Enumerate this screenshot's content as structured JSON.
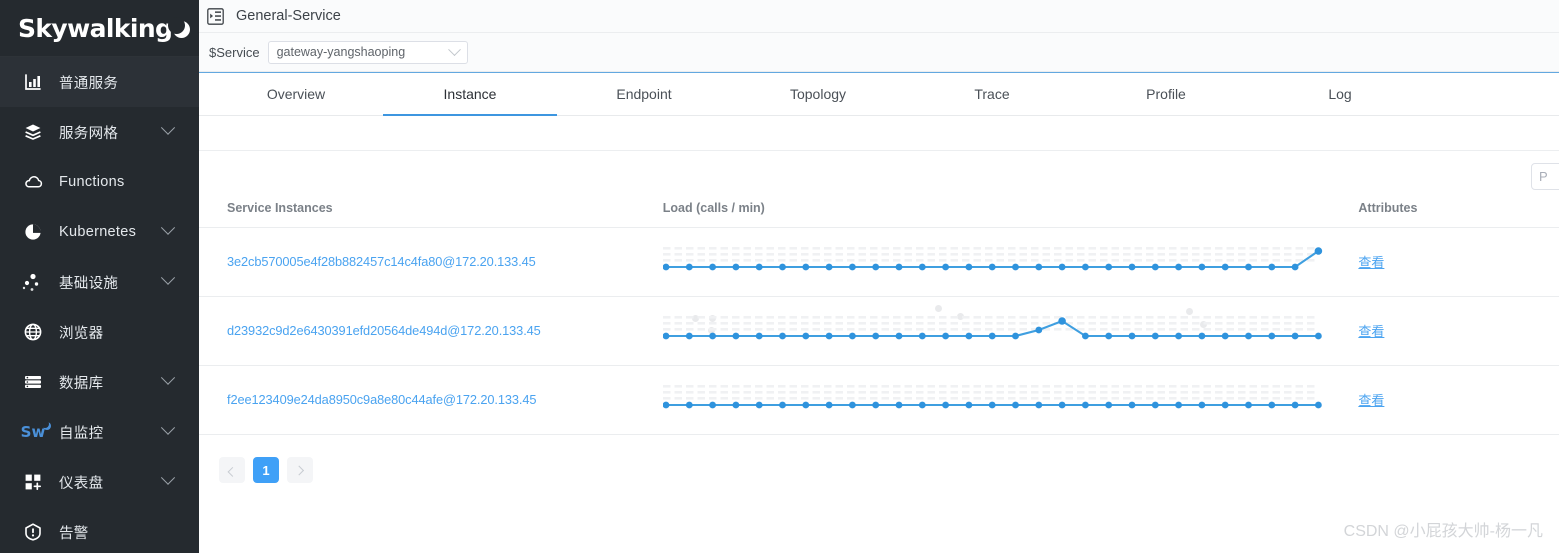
{
  "sidebar": {
    "logo": "Skywalking",
    "items": [
      {
        "label": "普通服务",
        "icon": "chart-bar-icon",
        "active": true,
        "expandable": false
      },
      {
        "label": "服务网格",
        "icon": "layers-icon",
        "active": false,
        "expandable": true
      },
      {
        "label": "Functions",
        "icon": "cloud-icon",
        "active": false,
        "expandable": false
      },
      {
        "label": "Kubernetes",
        "icon": "pie-chart-icon",
        "active": false,
        "expandable": true
      },
      {
        "label": "基础设施",
        "icon": "nodes-icon",
        "active": false,
        "expandable": true
      },
      {
        "label": "浏览器",
        "icon": "globe-icon",
        "active": false,
        "expandable": false
      },
      {
        "label": "数据库",
        "icon": "database-icon",
        "active": false,
        "expandable": true
      },
      {
        "label": "自监控",
        "icon": "skywalking-mark-icon",
        "active": false,
        "expandable": true
      },
      {
        "label": "仪表盘",
        "icon": "dashboard-add-icon",
        "active": false,
        "expandable": true
      },
      {
        "label": "告警",
        "icon": "alert-icon",
        "active": false,
        "expandable": false
      }
    ]
  },
  "topbar": {
    "collapse_icon": "menu-collapse-icon",
    "title": "General-Service"
  },
  "selector": {
    "label": "$Service",
    "value": "gateway-yangshaoping",
    "caret_icon": "chevron-down-icon"
  },
  "tabs": [
    {
      "label": "Overview",
      "active": false
    },
    {
      "label": "Instance",
      "active": true
    },
    {
      "label": "Endpoint",
      "active": false
    },
    {
      "label": "Topology",
      "active": false
    },
    {
      "label": "Trace",
      "active": false
    },
    {
      "label": "Profile",
      "active": false
    },
    {
      "label": "Log",
      "active": false
    }
  ],
  "toolbar": {
    "page_button_label": "P"
  },
  "table": {
    "headers": {
      "name": "Service Instances",
      "load": "Load (calls / min)",
      "attributes": "Attributes"
    },
    "attribute_link_label": "查看",
    "rows": [
      {
        "name": "3e2cb570005e4f28b882457c14c4fa80@172.20.133.45",
        "attribute": "查看"
      },
      {
        "name": "d23932c9d2e6430391efd20564de494d@172.20.133.45",
        "attribute": "查看"
      },
      {
        "name": "f2ee123409e24da8950c9a8e80c44afe@172.20.133.45",
        "attribute": "查看"
      }
    ]
  },
  "pagination": {
    "prev_label": "",
    "next_label": "",
    "pages": [
      "1"
    ],
    "current": "1"
  },
  "watermark": "CSDN @小屁孩大帅-杨一凡",
  "colors": {
    "sidebar_bg": "#252a2f",
    "accent": "#3d96e0",
    "link": "#4aa3f0",
    "spark_line": "#3f9fe0",
    "page_active": "#3fa0f7"
  },
  "chart_data": [
    {
      "type": "line",
      "title": "Load (calls / min)",
      "row": "3e2cb570005e4f28b882457c14c4fa80@172.20.133.45",
      "xlabel": "",
      "ylabel": "calls / min",
      "grid": true,
      "legend": "none",
      "x": [
        0,
        1,
        2,
        3,
        4,
        5,
        6,
        7,
        8,
        9,
        10,
        11,
        12,
        13,
        14,
        15,
        16,
        17,
        18,
        19,
        20,
        21,
        22,
        23,
        24,
        25,
        26,
        27,
        28
      ],
      "values": [
        1,
        1,
        1,
        1,
        1,
        1,
        1,
        1,
        1,
        1,
        1,
        1,
        1,
        1,
        1,
        1,
        1,
        1,
        1,
        1,
        1,
        1,
        1,
        1,
        1,
        1,
        1,
        1,
        3
      ],
      "ylim": [
        0,
        3.4
      ]
    },
    {
      "type": "line",
      "title": "Load (calls / min)",
      "row": "d23932c9d2e6430391efd20564de494d@172.20.133.45",
      "xlabel": "",
      "ylabel": "calls / min",
      "grid": true,
      "legend": "none",
      "x": [
        0,
        1,
        2,
        3,
        4,
        5,
        6,
        7,
        8,
        9,
        10,
        11,
        12,
        13,
        14,
        15,
        16,
        17,
        18,
        19,
        20,
        21,
        22,
        23,
        24,
        25,
        26,
        27,
        28
      ],
      "values": [
        1,
        1,
        1,
        1,
        1,
        1,
        1,
        1,
        1,
        1,
        1,
        1,
        1,
        1,
        1,
        1,
        1.6,
        2.6,
        1,
        1,
        1,
        1,
        1,
        1,
        1,
        1,
        1,
        1,
        1
      ],
      "ylim": [
        0,
        3.4
      ]
    },
    {
      "type": "line",
      "title": "Load (calls / min)",
      "row": "f2ee123409e24da8950c9a8e80c44afe@172.20.133.45",
      "xlabel": "",
      "ylabel": "calls / min",
      "grid": true,
      "legend": "none",
      "x": [
        0,
        1,
        2,
        3,
        4,
        5,
        6,
        7,
        8,
        9,
        10,
        11,
        12,
        13,
        14,
        15,
        16,
        17,
        18,
        19,
        20,
        21,
        22,
        23,
        24,
        25,
        26,
        27,
        28
      ],
      "values": [
        1,
        1,
        1,
        1,
        1,
        1,
        1,
        1,
        1,
        1,
        1,
        1,
        1,
        1,
        1,
        1,
        1,
        1,
        1,
        1,
        1,
        1,
        1,
        1,
        1,
        1,
        1,
        1,
        1
      ],
      "ylim": [
        0,
        3.4
      ]
    }
  ]
}
